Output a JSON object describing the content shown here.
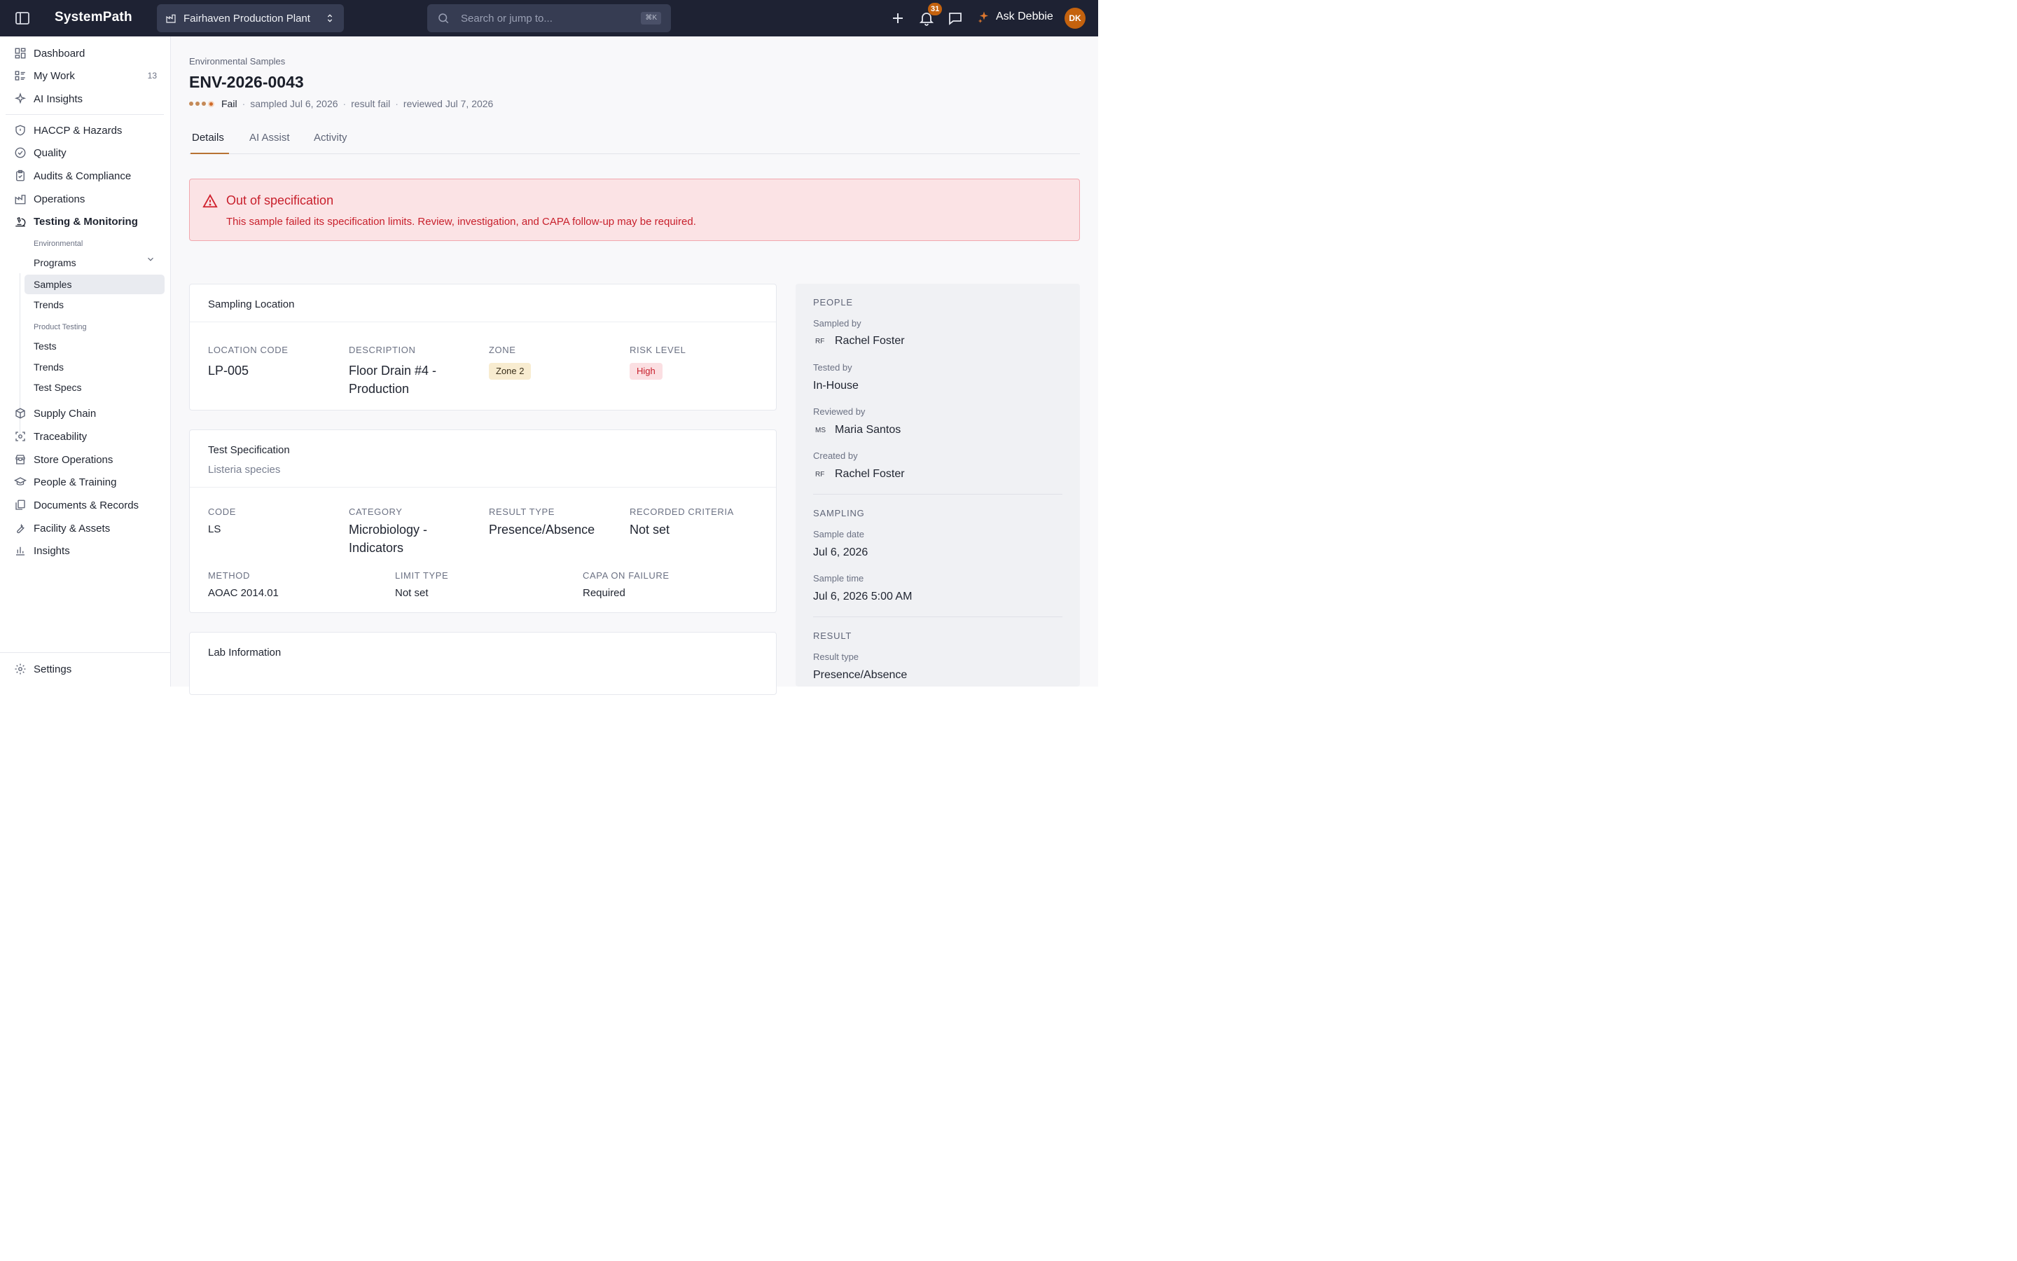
{
  "app": {
    "brand": "SystemPath",
    "site": "Fairhaven Production Plant",
    "search_placeholder": "Search or jump to...",
    "search_shortcut": "⌘K",
    "notifications_count": "31",
    "ask_label": "Ask Debbie",
    "avatar_initials": "DK"
  },
  "sidebar": {
    "top_items": [
      {
        "label": "Dashboard",
        "icon": "dashboard-icon"
      },
      {
        "label": "My Work",
        "icon": "list-icon",
        "count": "13"
      },
      {
        "label": "AI Insights",
        "icon": "sparkle-icon"
      }
    ],
    "items": [
      {
        "label": "HACCP & Hazards",
        "icon": "shield-icon"
      },
      {
        "label": "Quality",
        "icon": "check-circle-icon"
      },
      {
        "label": "Audits & Compliance",
        "icon": "clipboard-icon"
      },
      {
        "label": "Operations",
        "icon": "factory-icon"
      },
      {
        "label": "Testing & Monitoring",
        "icon": "microscope-icon"
      }
    ],
    "testing_sub": {
      "group1": "Environmental",
      "group1_items": [
        "Programs",
        "Samples",
        "Trends"
      ],
      "group2": "Product Testing",
      "group2_items": [
        "Tests",
        "Trends",
        "Test Specs"
      ]
    },
    "items2": [
      {
        "label": "Supply Chain",
        "icon": "package-icon"
      },
      {
        "label": "Traceability",
        "icon": "scan-icon"
      },
      {
        "label": "Store Operations",
        "icon": "store-icon"
      },
      {
        "label": "People & Training",
        "icon": "graduation-cap-icon"
      },
      {
        "label": "Documents & Records",
        "icon": "documents-icon"
      },
      {
        "label": "Facility & Assets",
        "icon": "wrench-icon"
      },
      {
        "label": "Insights",
        "icon": "bar-chart-icon"
      }
    ],
    "settings": "Settings"
  },
  "page": {
    "breadcrumb": "Environmental Samples",
    "title": "ENV-2026-0043",
    "status": "Fail",
    "sampled": "sampled Jul 6, 2026",
    "result": "result fail",
    "reviewed": "reviewed Jul 7, 2026",
    "tabs": [
      "Details",
      "AI Assist",
      "Activity"
    ]
  },
  "alert": {
    "title": "Out of specification",
    "message": "This sample failed its specification limits. Review, investigation, and CAPA follow-up may be required."
  },
  "sampling_location": {
    "title": "Sampling Location",
    "location_code_label": "Location Code",
    "location_code": "LP-005",
    "description_label": "Description",
    "description_line1": "Floor Drain #4 -",
    "description_line2": "Production",
    "zone_label": "Zone",
    "zone": "Zone 2",
    "risk_label": "Risk Level",
    "risk": "High"
  },
  "test_spec": {
    "title": "Test Specification",
    "subtitle": "Listeria species",
    "code_label": "Code",
    "code": "LS",
    "category_label": "Category",
    "category_line1": "Microbiology -",
    "category_line2": "Indicators",
    "result_type_label": "Result Type",
    "result_type": "Presence/Absence",
    "criteria_label": "Recorded Criteria",
    "criteria": "Not set",
    "method_label": "Method",
    "method": "AOAC 2014.01",
    "limit_label": "Limit Type",
    "limit": "Not set",
    "capa_label": "CAPA on Failure",
    "capa": "Required"
  },
  "lab": {
    "title": "Lab Information"
  },
  "right_panel": {
    "people_head": "PEOPLE",
    "sampled_by_label": "Sampled by",
    "sampled_by_initials": "RF",
    "sampled_by": "Rachel Foster",
    "tested_by_label": "Tested by",
    "tested_by": "In-House",
    "reviewed_by_label": "Reviewed by",
    "reviewed_by_initials": "MS",
    "reviewed_by": "Maria Santos",
    "created_by_label": "Created by",
    "created_by_initials": "RF",
    "created_by": "Rachel Foster",
    "sampling_head": "SAMPLING",
    "sample_date_label": "Sample date",
    "sample_date": "Jul 6, 2026",
    "sample_time_label": "Sample time",
    "sample_time": "Jul 6, 2026 5:00 AM",
    "result_head": "RESULT",
    "result_type_label": "Result type",
    "result_type": "Presence/Absence"
  },
  "colors": {
    "topbar": "#1e2233",
    "accent": "#c4620e",
    "danger": "#c8202c",
    "alert_bg": "#fbe3e5"
  }
}
